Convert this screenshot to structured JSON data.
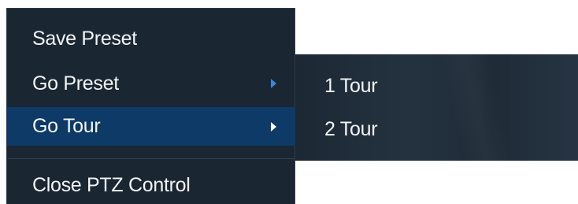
{
  "context_menu": {
    "items": [
      {
        "label": "Save Preset",
        "has_submenu": false
      },
      {
        "label": "Go Preset",
        "has_submenu": true
      },
      {
        "label": "Go Tour",
        "has_submenu": true,
        "active": true
      },
      {
        "label": "Close PTZ Control",
        "has_submenu": false
      }
    ]
  },
  "submenu": {
    "items": [
      {
        "label": "1 Tour"
      },
      {
        "label": "2 Tour"
      }
    ]
  },
  "colors": {
    "menu_background": "#1a2632",
    "active_background": "#0d3a66",
    "text": "#f2f4f6",
    "arrow": "#3d86d0",
    "active_arrow": "#ffffff"
  },
  "icons": {
    "submenu_arrow": "chevron-right-icon"
  }
}
